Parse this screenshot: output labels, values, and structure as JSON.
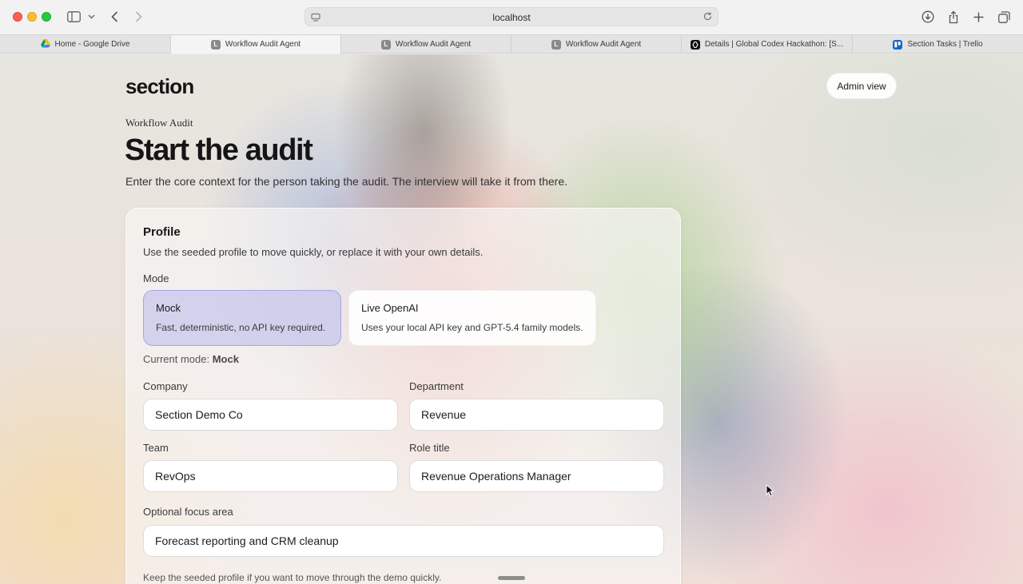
{
  "browser": {
    "url": "localhost",
    "tabs": [
      {
        "title": "Home - Google Drive",
        "favicon": "google-drive-icon",
        "active": false
      },
      {
        "title": "Workflow Audit Agent",
        "favicon": "L",
        "active": true
      },
      {
        "title": "Workflow Audit Agent",
        "favicon": "L",
        "active": false
      },
      {
        "title": "Workflow Audit Agent",
        "favicon": "L",
        "active": false
      },
      {
        "title": "Details | Global Codex Hackathon: [S...",
        "favicon": "devpost-icon",
        "active": false
      },
      {
        "title": "Section Tasks | Trello",
        "favicon": "trello-icon",
        "active": false
      }
    ]
  },
  "header": {
    "brand": "section",
    "admin_label": "Admin view"
  },
  "intro": {
    "eyebrow": "Workflow Audit",
    "title": "Start the audit",
    "lede": "Enter the core context for the person taking the audit. The interview will take it from there."
  },
  "profile": {
    "title": "Profile",
    "subtitle": "Use the seeded profile to move quickly, or replace it with your own details.",
    "mode_label": "Mode",
    "modes": [
      {
        "name": "Mock",
        "desc": "Fast, deterministic, no API key required.",
        "selected": true
      },
      {
        "name": "Live OpenAI",
        "desc": "Uses your local API key and GPT-5.4 family models.",
        "selected": false
      }
    ],
    "current_mode_prefix": "Current mode:",
    "current_mode_value": "Mock",
    "fields": {
      "company": {
        "label": "Company",
        "value": "Section Demo Co"
      },
      "department": {
        "label": "Department",
        "value": "Revenue"
      },
      "team": {
        "label": "Team",
        "value": "RevOps"
      },
      "role": {
        "label": "Role title",
        "value": "Revenue Operations Manager"
      },
      "focus": {
        "label": "Optional focus area",
        "value": "Forecast reporting and CRM cleanup"
      }
    },
    "footer_note": "Keep the seeded profile if you want to move through the demo quickly."
  },
  "colors": {
    "selected_mode_bg": "#c4c4ec",
    "selected_mode_border": "#a7a5e6",
    "text_primary": "#151515"
  }
}
